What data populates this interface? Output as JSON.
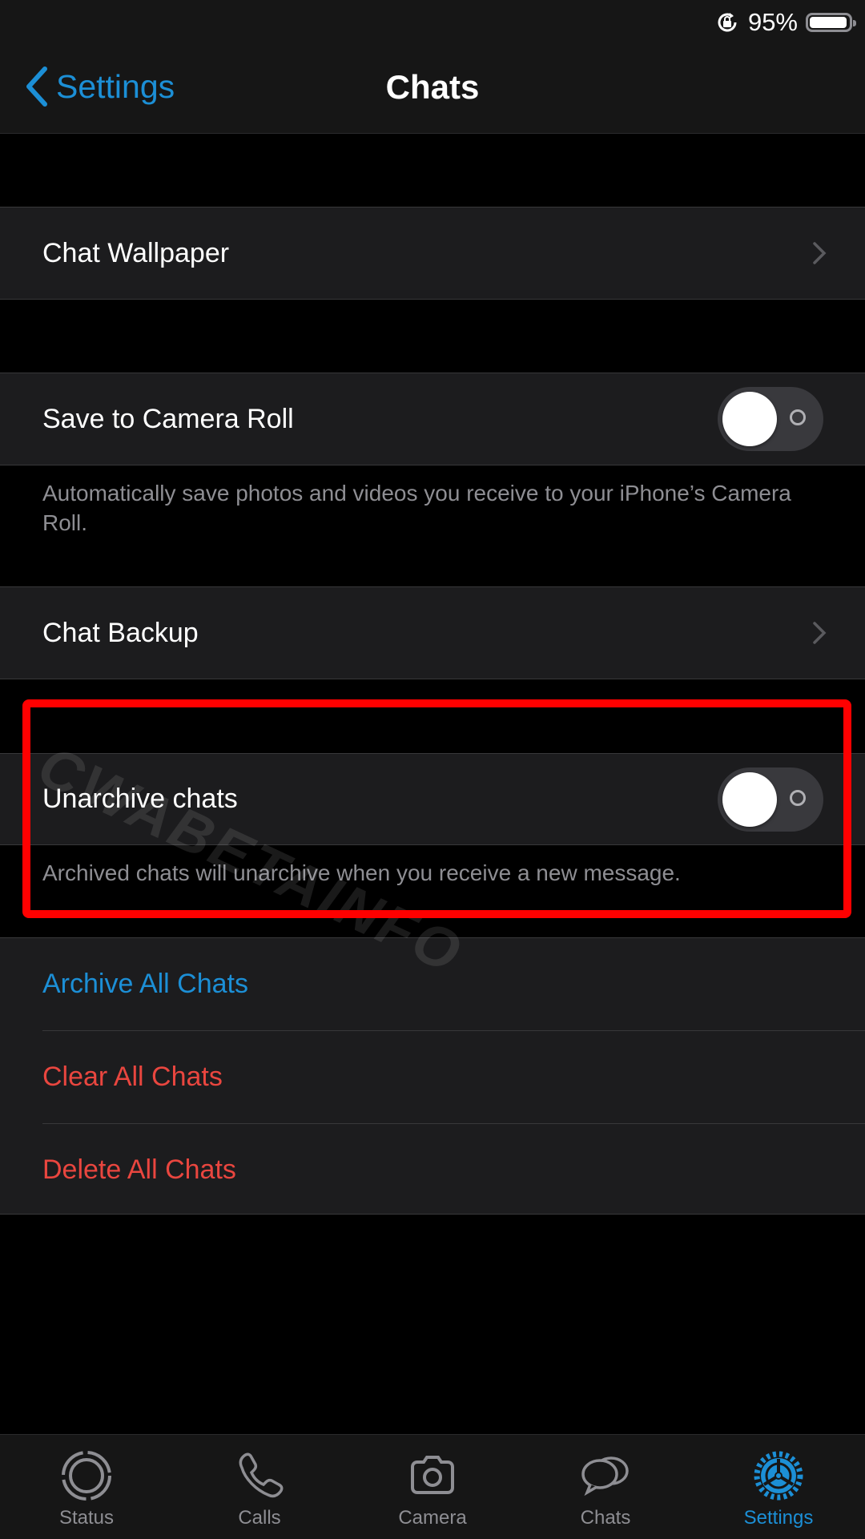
{
  "status_bar": {
    "battery_percent": "95%",
    "battery_level": 0.95,
    "icons": [
      "orientation-lock-icon",
      "battery-icon"
    ]
  },
  "nav": {
    "back_label": "Settings",
    "title": "Chats"
  },
  "sections": {
    "chat_wallpaper": {
      "label": "Chat Wallpaper"
    },
    "save_camera_roll": {
      "label": "Save to Camera Roll",
      "enabled": false,
      "footer": "Automatically save photos and videos you receive to your iPhone’s Camera Roll."
    },
    "chat_backup": {
      "label": "Chat Backup"
    },
    "unarchive": {
      "label": "Unarchive chats",
      "enabled": false,
      "footer": "Archived chats will unarchive when you receive a new message."
    }
  },
  "actions": [
    {
      "label": "Archive All Chats",
      "color": "#1c8fd6"
    },
    {
      "label": "Clear All Chats",
      "color": "#e9463f"
    },
    {
      "label": "Delete All Chats",
      "color": "#e9463f"
    }
  ],
  "watermark": "CWABETAINFO",
  "highlight_color": "#ff0000",
  "tabs": [
    {
      "label": "Status",
      "icon": "status-icon",
      "active": false
    },
    {
      "label": "Calls",
      "icon": "phone-icon",
      "active": false
    },
    {
      "label": "Camera",
      "icon": "camera-icon",
      "active": false
    },
    {
      "label": "Chats",
      "icon": "chats-icon",
      "active": false
    },
    {
      "label": "Settings",
      "icon": "gear-icon",
      "active": true
    }
  ],
  "accent": "#1c8fd6"
}
